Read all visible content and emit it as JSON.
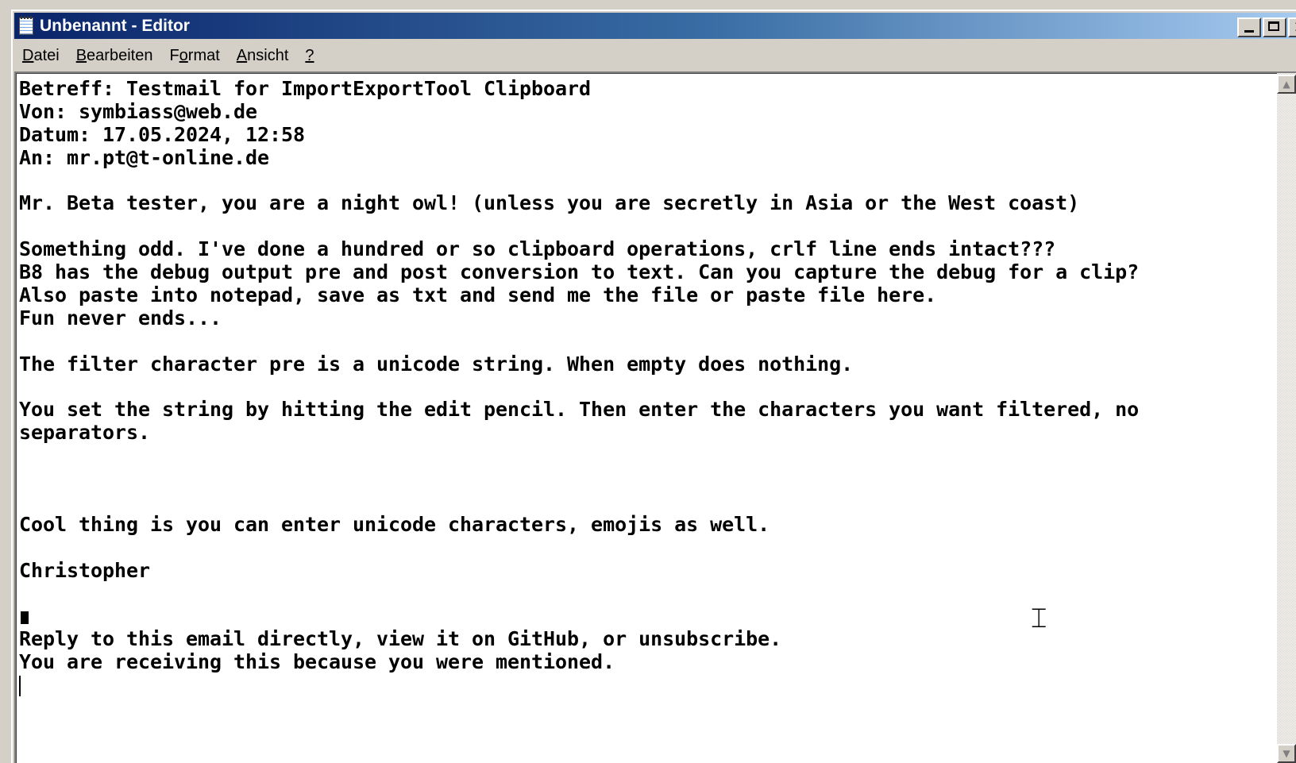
{
  "window": {
    "title": "Unbenannt - Editor"
  },
  "title_buttons": {
    "close_glyph": "✕"
  },
  "menu": [
    {
      "label": "Datei"
    },
    {
      "label": "Bearbeiten"
    },
    {
      "label": "Format"
    },
    {
      "label": "Ansicht"
    },
    {
      "label": "?"
    }
  ],
  "document": {
    "lines": [
      "Betreff: Testmail for ImportExportTool Clipboard",
      "Von: symbiass@web.de",
      "Datum: 17.05.2024, 12:58",
      "An: mr.pt@t-online.de",
      "",
      "Mr. Beta tester, you are a night owl! (unless you are secretly in Asia or the West coast)",
      "",
      "Something odd. I've done a hundred or so clipboard operations, crlf line ends intact???",
      "B8 has the debug output pre and post conversion to text. Can you capture the debug for a clip?",
      "Also paste into notepad, save as txt and send me the file or paste file here.",
      "Fun never ends...",
      "",
      "The filter character pre is a unicode string. When empty does nothing.",
      "",
      "You set the string by hitting the edit pencil. Then enter the characters you want filtered, no",
      "separators.",
      "",
      "",
      "",
      "Cool thing is you can enter unicode characters, emojis as well.",
      "",
      "Christopher",
      "",
      "",
      "Reply to this email directly, view it on GitHub, or unsubscribe.",
      "You are receiving this because you were mentioned.",
      ""
    ]
  },
  "scrollbar": {
    "up_glyph": "▲",
    "down_glyph": "▼"
  }
}
